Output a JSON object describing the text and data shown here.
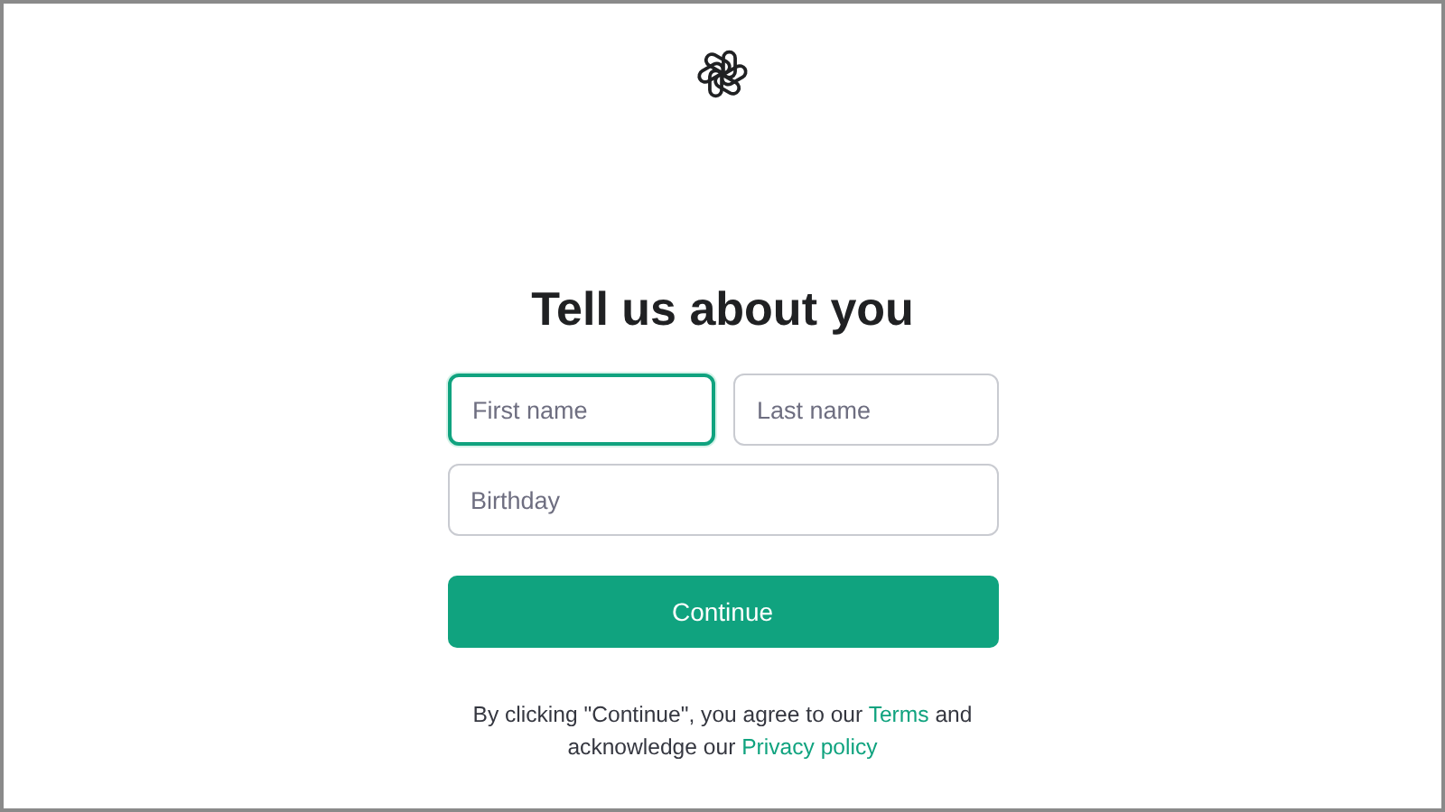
{
  "heading": "Tell us about you",
  "field_rows": [
    [
      {
        "placeholder": "First name",
        "focused": true
      },
      {
        "placeholder": "Last name",
        "focused": false
      }
    ],
    [
      {
        "placeholder": "Birthday",
        "focused": false
      }
    ]
  ],
  "button": "Continue",
  "legal": {
    "before": "By clicking \"Continue\", you agree to our",
    "terms_link": "Terms",
    "middle": "and acknowledge our",
    "privacy_link": "Privacy policy"
  }
}
